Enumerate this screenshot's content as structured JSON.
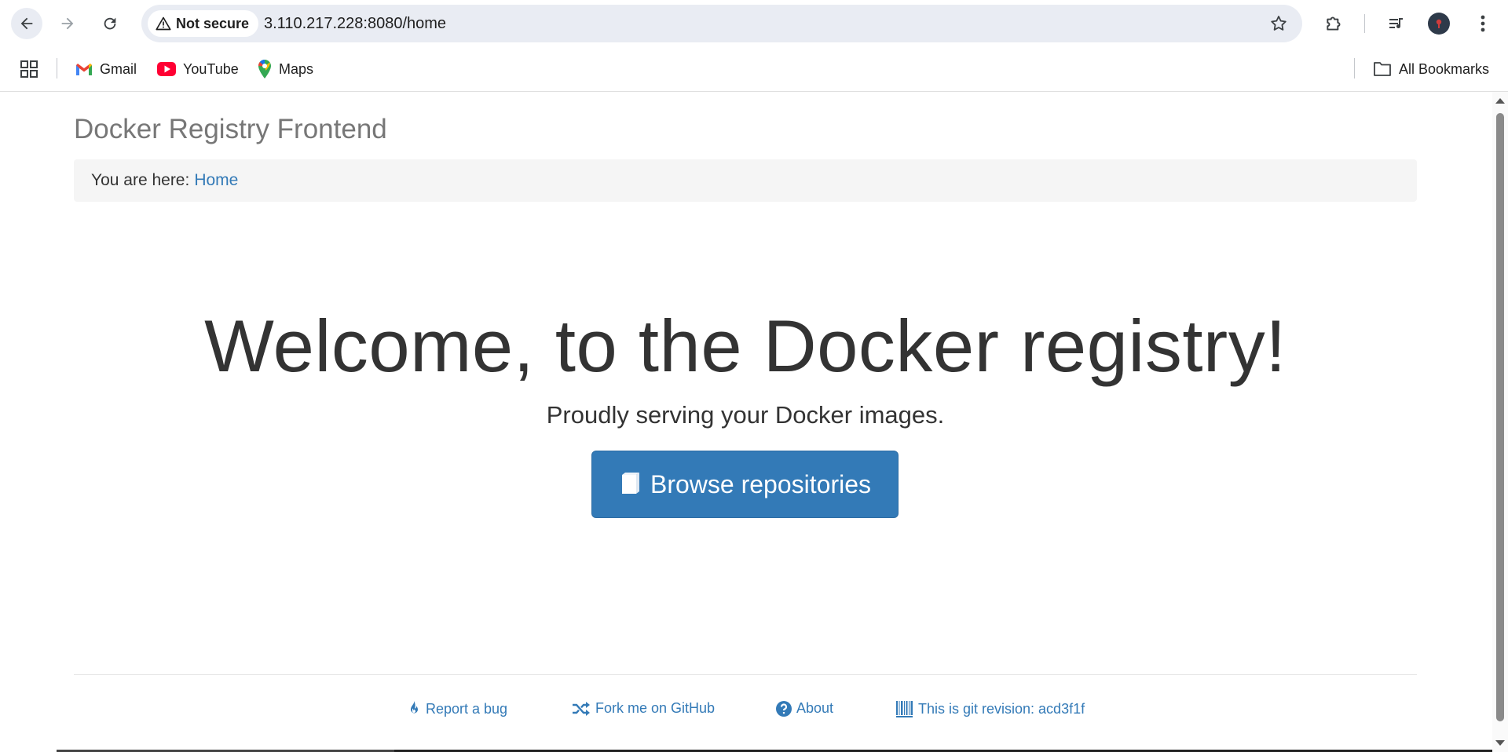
{
  "browser": {
    "security_label": "Not secure",
    "url": "3.110.217.228:8080/home",
    "bookmarks": [
      {
        "label": "Gmail",
        "icon": "gmail-icon"
      },
      {
        "label": "YouTube",
        "icon": "youtube-icon"
      },
      {
        "label": "Maps",
        "icon": "maps-icon"
      }
    ],
    "all_bookmarks_label": "All Bookmarks"
  },
  "page": {
    "brand": "Docker Registry Frontend",
    "breadcrumb_prefix": "You are here:",
    "breadcrumb_home": "Home",
    "hero_title": "Welcome, to the Docker registry!",
    "hero_subtitle": "Proudly serving your Docker images.",
    "browse_button": "Browse repositories",
    "footer": {
      "report_bug": "Report a bug",
      "fork_github": "Fork me on GitHub",
      "about": "About",
      "git_revision": "This is git revision: acd3f1f"
    }
  },
  "colors": {
    "link": "#337ab7",
    "primary_button": "#337ab7",
    "breadcrumb_bg": "#f5f5f5",
    "brand_text": "#777777"
  }
}
